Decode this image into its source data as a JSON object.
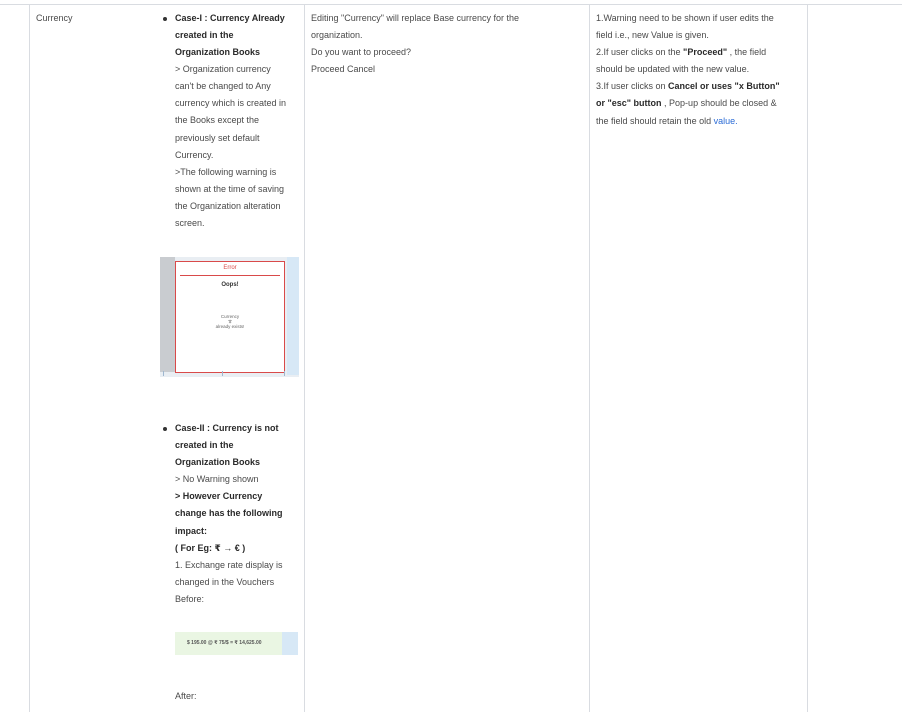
{
  "row": {
    "field": "Currency",
    "case1": {
      "title": "Case-I : Currency Already created in the Organization Books",
      "title_lines": [
        "Case-I : Currency Already",
        "created in the",
        "Organization Books"
      ],
      "desc_lines": [
        "> Organization currency",
        "can't be changed to Any",
        "currency which is created in",
        "the Books except the",
        "previously set default",
        "Currency.",
        ">The following warning is",
        "shown at the time of saving",
        "the Organization alteration",
        "screen."
      ],
      "error_image": {
        "title": "Error",
        "heading": "Oops!",
        "message_lines": [
          "Currency",
          "'$'",
          "already exists!"
        ]
      }
    },
    "case2": {
      "title_lines": [
        "Case-II : Currency is not",
        "created in the",
        "Organization Books"
      ],
      "no_warning": "> No Warning shown",
      "impact_lines": [
        "> However Currency",
        "change has the following",
        "impact:",
        "( For Eg: ₹ → € )"
      ],
      "exchange_lines": [
        "1. Exchange rate display is",
        "changed in the Vouchers"
      ],
      "before_label": "Before:",
      "rate_example": "$ 195.00 @ ₹ 75/$ = ₹ 14,625.00",
      "after_label": "After:"
    },
    "message": {
      "lines": [
        "Editing \"Currency\" will replace Base currency for the",
        "organization.",
        "Do you want to proceed?",
        "Proceed Cancel"
      ]
    },
    "expected": {
      "l1": "1.Warning need to be shown if user edits the",
      "l2": "field i.e., new Value is given.",
      "l3_a": "2.If user clicks on the ",
      "l3_b": "\"Proceed\"",
      "l3_c": " , the field",
      "l4": "should be updated with the new value.",
      "l5_a": "3.If user clicks on ",
      "l5_b": "Cancel or uses \"x Button\"",
      "l6_a": "or \"esc\" button",
      "l6_b": " , Pop-up should be closed &",
      "l7_a": "the field should retain the old ",
      "l7_link": "value."
    }
  }
}
